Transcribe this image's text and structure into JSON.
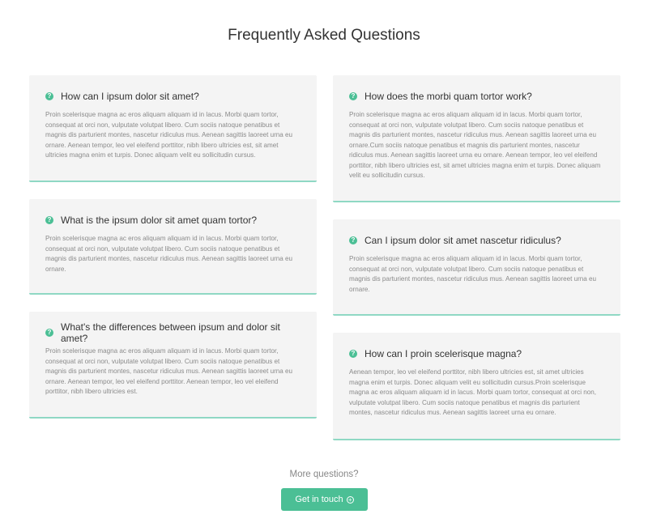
{
  "page_title": "Frequently Asked Questions",
  "colors": {
    "accent": "#4bbf95",
    "card_bg": "#f4f4f4",
    "card_border": "#8fd8c4"
  },
  "left": [
    {
      "question": "How can I ipsum dolor sit amet?",
      "answer": "Proin scelerisque magna ac eros aliquam aliquam id in lacus. Morbi quam tortor, consequat at orci non, vulputate volutpat libero. Cum sociis natoque penatibus et magnis dis parturient montes, nascetur ridiculus mus. Aenean sagittis laoreet urna eu ornare. Aenean tempor, leo vel eleifend porttitor, nibh libero ultricies est, sit amet ultricies magna enim et turpis. Donec aliquam velit eu sollicitudin cursus."
    },
    {
      "question": "What is the ipsum dolor sit amet quam tortor?",
      "answer": "Proin scelerisque magna ac eros aliquam aliquam id in lacus. Morbi quam tortor, consequat at orci non, vulputate volutpat libero. Cum sociis natoque penatibus et magnis dis parturient montes, nascetur ridiculus mus. Aenean sagittis laoreet urna eu ornare."
    },
    {
      "question": "What's the differences between ipsum and dolor sit amet?",
      "answer": "Proin scelerisque magna ac eros aliquam aliquam id in lacus. Morbi quam tortor, consequat at orci non, vulputate volutpat libero. Cum sociis natoque penatibus et magnis dis parturient montes, nascetur ridiculus mus. Aenean sagittis laoreet urna eu ornare. Aenean tempor, leo vel eleifend porttitor. Aenean tempor, leo vel eleifend porttitor, nibh libero ultricies est."
    }
  ],
  "right": [
    {
      "question": "How does the morbi quam tortor work?",
      "answer": "Proin scelerisque magna ac eros aliquam aliquam id in lacus. Morbi quam tortor, consequat at orci non, vulputate volutpat libero. Cum sociis natoque penatibus et magnis dis parturient montes, nascetur ridiculus mus. Aenean sagittis laoreet urna eu ornare.Cum sociis natoque penatibus et magnis dis parturient montes, nascetur ridiculus mus. Aenean sagittis laoreet urna eu ornare. Aenean tempor, leo vel eleifend porttitor, nibh libero ultricies est, sit amet ultricies magna enim et turpis. Donec aliquam velit eu sollicitudin cursus."
    },
    {
      "question": "Can I ipsum dolor sit amet nascetur ridiculus?",
      "answer": "Proin scelerisque magna ac eros aliquam aliquam id in lacus. Morbi quam tortor, consequat at orci non, vulputate volutpat libero. Cum sociis natoque penatibus et magnis dis parturient montes, nascetur ridiculus mus. Aenean sagittis laoreet urna eu ornare."
    },
    {
      "question": "How can I proin scelerisque magna?",
      "answer": "Aenean tempor, leo vel eleifend porttitor, nibh libero ultricies est, sit amet ultricies magna enim et turpis. Donec aliquam velit eu sollicitudin cursus.Proin scelerisque magna ac eros aliquam aliquam id in lacus. Morbi quam tortor, consequat at orci non, vulputate volutpat libero. Cum sociis natoque penatibus et magnis dis parturient montes, nascetur ridiculus mus. Aenean sagittis laoreet urna eu ornare."
    }
  ],
  "footer": {
    "more_text": "More questions?",
    "cta_label": "Get in touch"
  }
}
